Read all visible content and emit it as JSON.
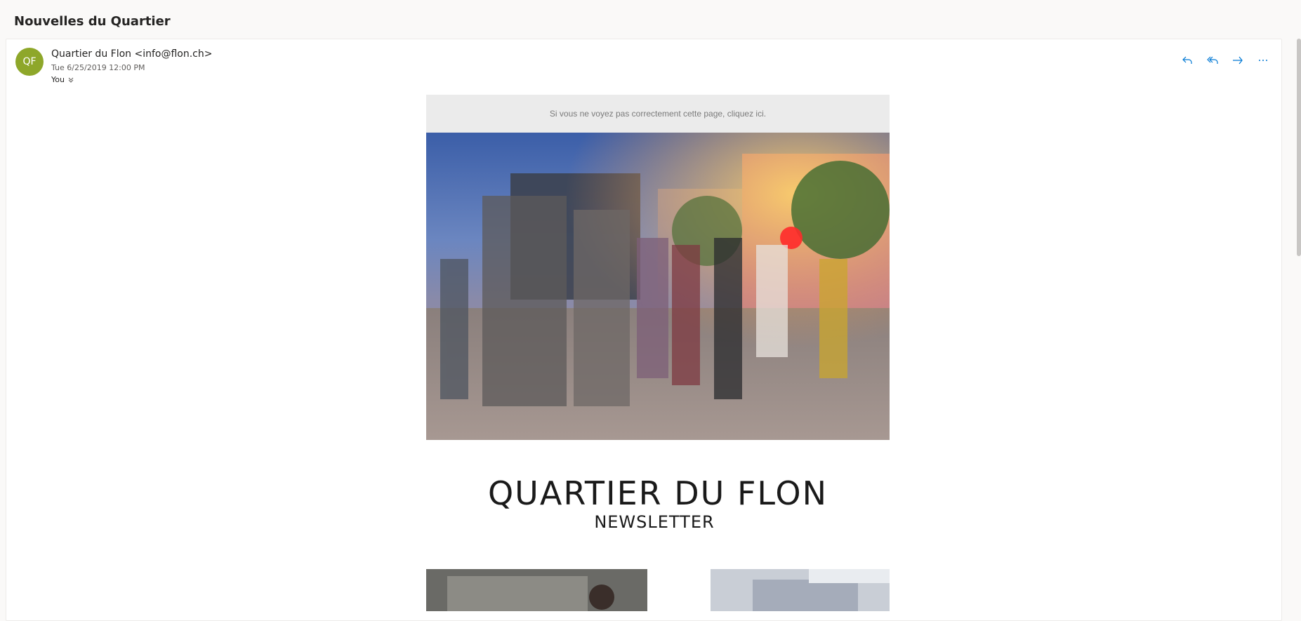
{
  "email": {
    "subject": "Nouvelles du Quartier",
    "avatar_initials": "QF",
    "avatar_color": "#8ea72a",
    "sender": "Quartier du Flon <info@flon.ch>",
    "date": "Tue 6/25/2019 12:00 PM",
    "to": "You",
    "actions": [
      {
        "icon": "reply-icon"
      },
      {
        "icon": "reply-all-icon"
      },
      {
        "icon": "forward-icon"
      },
      {
        "icon": "more-icon"
      }
    ],
    "accent_color": "#0078d4"
  },
  "newsletter": {
    "preheader": "Si vous ne voyez pas correctement cette page, cliquez ici.",
    "hero_alt": "night-dancing-square-photo",
    "brand_title": "QUARTIER DU FLON",
    "brand_subtitle": "NEWSLETTER"
  }
}
